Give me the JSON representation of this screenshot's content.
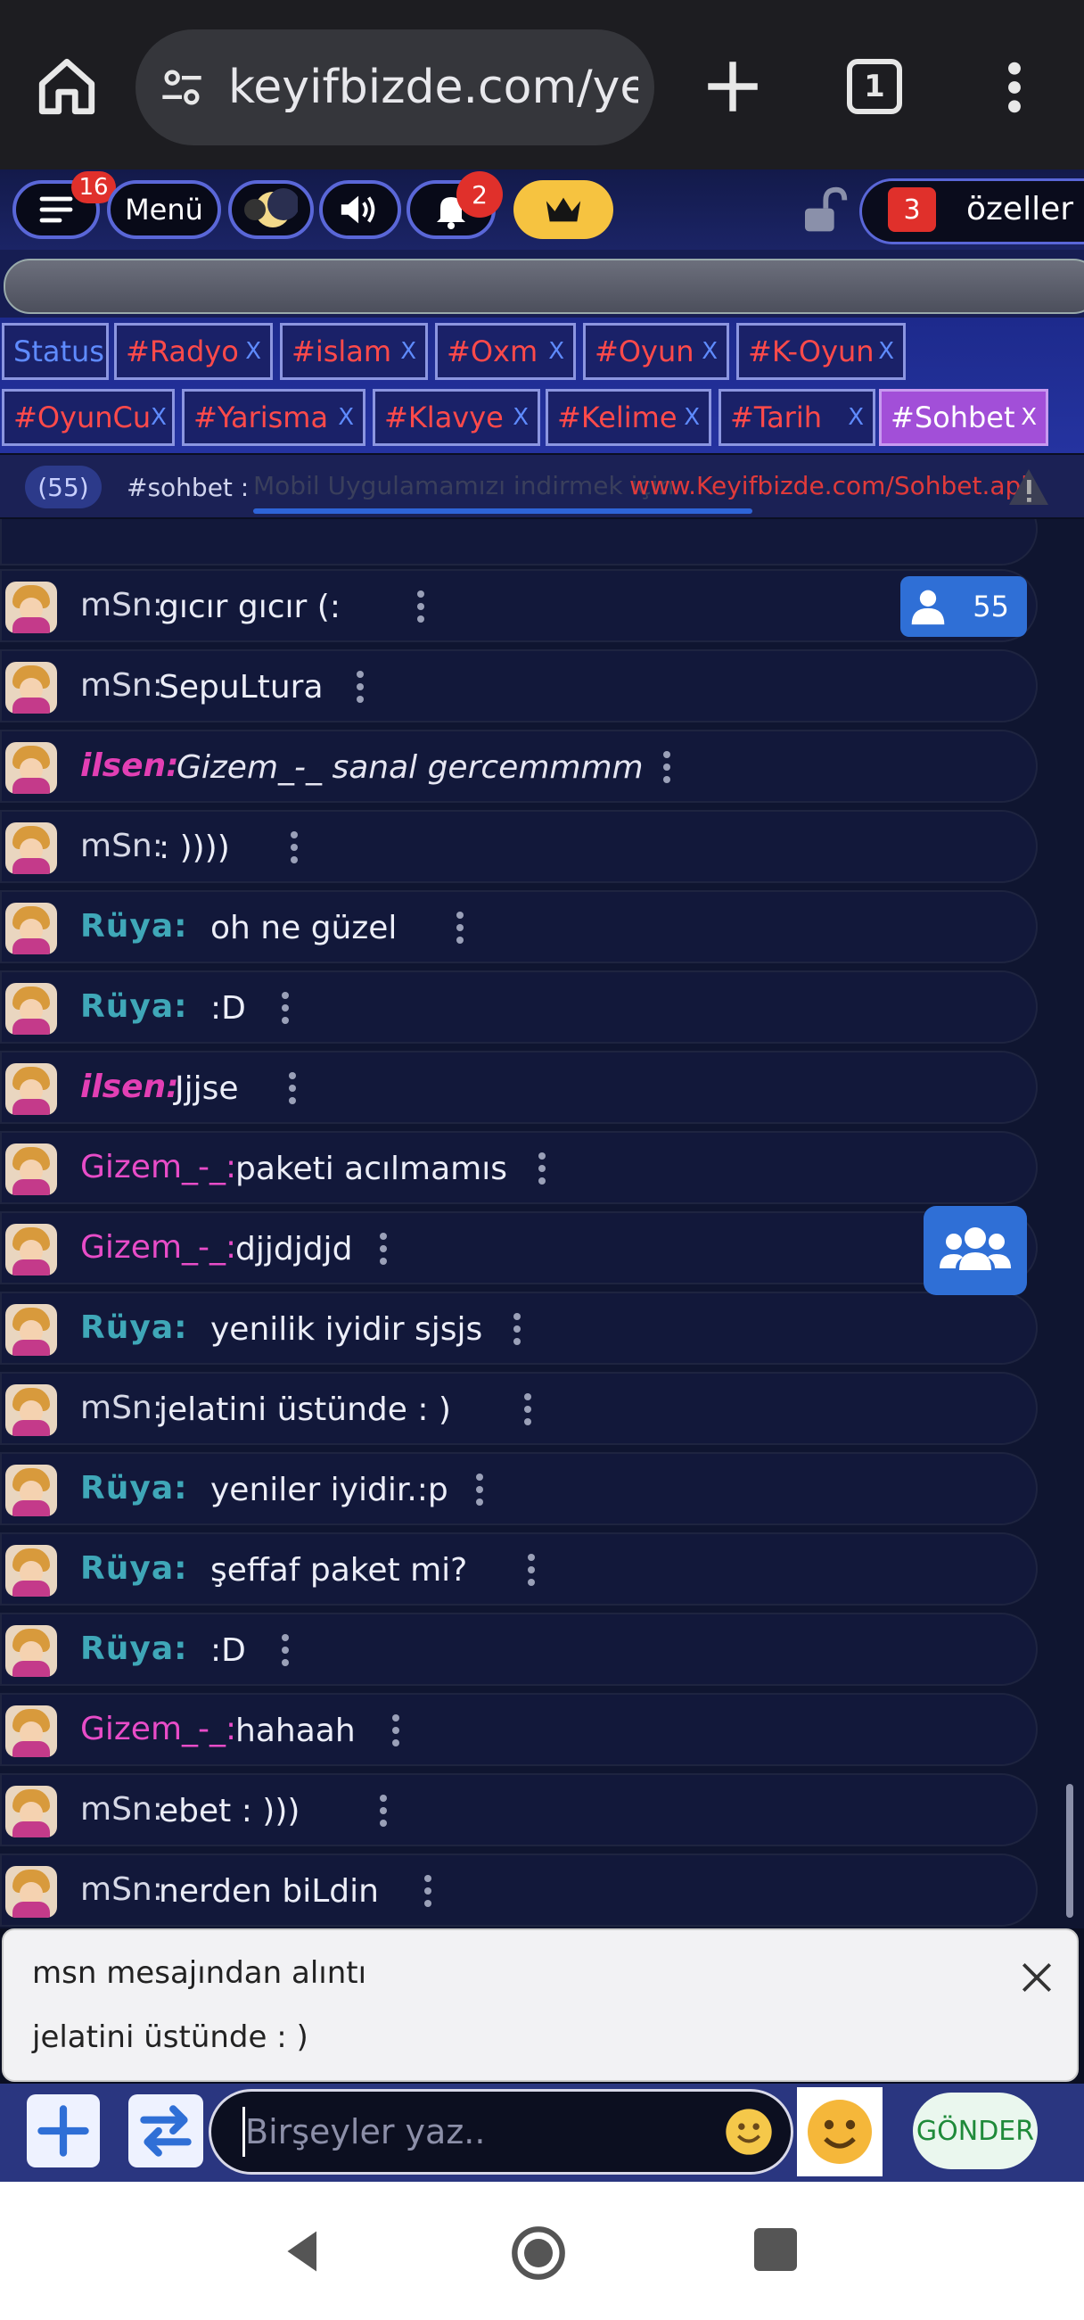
{
  "browser": {
    "url": "keyifbizde.com/yen",
    "tab_count": "1"
  },
  "toolbar": {
    "hamburger_badge": "16",
    "menu_label": "Menü",
    "notif_badge": "2",
    "private_badge": "3",
    "private_label": "özeller"
  },
  "tabs_row1": [
    {
      "label": "Status",
      "x": ""
    },
    {
      "label": "#Radyo",
      "x": "X"
    },
    {
      "label": "#islam",
      "x": "X"
    },
    {
      "label": "#Oxm",
      "x": "X"
    },
    {
      "label": "#Oyun",
      "x": "X"
    },
    {
      "label": "#K-Oyun",
      "x": "X"
    }
  ],
  "tabs_row2": [
    {
      "label": "#OyunCu",
      "x": "X"
    },
    {
      "label": "#Yarisma",
      "x": "X"
    },
    {
      "label": "#Klavye",
      "x": "X"
    },
    {
      "label": "#Kelime",
      "x": "X"
    },
    {
      "label": "#Tarih",
      "x": "X"
    },
    {
      "label": "#Sohbet",
      "x": "X"
    }
  ],
  "marquee": {
    "count": "(55)",
    "channel": "#sohbet :",
    "text": "Mobil Uygulamamızı indirmek için",
    "url": "www.Keyifbizde.com/Sohbet.apk"
  },
  "online_count": "55",
  "messages": [
    {
      "nick": "mSn:",
      "type": "msn",
      "text": "gıcır gıcır (:"
    },
    {
      "nick": "mSn:",
      "type": "msn",
      "text": "SepuLtura"
    },
    {
      "nick": "ilsen:",
      "type": "ilsen",
      "text": "Gizem_-_ sanal gercemmmm"
    },
    {
      "nick": "mSn:",
      "type": "msn",
      "text": ": ))))"
    },
    {
      "nick": "Rüya:",
      "type": "ruya",
      "text": "oh ne güzel"
    },
    {
      "nick": "Rüya:",
      "type": "ruya",
      "text": ":D"
    },
    {
      "nick": "ilsen:",
      "type": "ilsen",
      "text": "Jjjse"
    },
    {
      "nick": "Gizem_-_:",
      "type": "gizem",
      "text": "paketi acılmamıs"
    },
    {
      "nick": "Gizem_-_:",
      "type": "gizem",
      "text": "djjdjdjd"
    },
    {
      "nick": "Rüya:",
      "type": "ruya",
      "text": "yenilik iyidir sjsjs"
    },
    {
      "nick": "mSn:",
      "type": "msn",
      "text": "jelatini üstünde : )"
    },
    {
      "nick": "Rüya:",
      "type": "ruya",
      "text": "yeniler iyidir.:p"
    },
    {
      "nick": "Rüya:",
      "type": "ruya",
      "text": "şeffaf paket mi?"
    },
    {
      "nick": "Rüya:",
      "type": "ruya",
      "text": ":D"
    },
    {
      "nick": "Gizem_-_:",
      "type": "gizem",
      "text": "hahaah"
    },
    {
      "nick": "mSn:",
      "type": "msn",
      "text": "ebet : )))"
    },
    {
      "nick": "mSn:",
      "type": "msn",
      "text": "nerden biLdin"
    }
  ],
  "quote": {
    "title": "msn mesajından alıntı",
    "body": "jelatini üstünde : )"
  },
  "composer": {
    "placeholder": "Birşeyler yaz..",
    "send_label": "GÖNDER"
  },
  "colors": {
    "accent": "#2f6fd6",
    "tab_red": "#ff4a4a",
    "nick_pink": "#e84cc8",
    "nick_teal": "#3fa7b8"
  }
}
